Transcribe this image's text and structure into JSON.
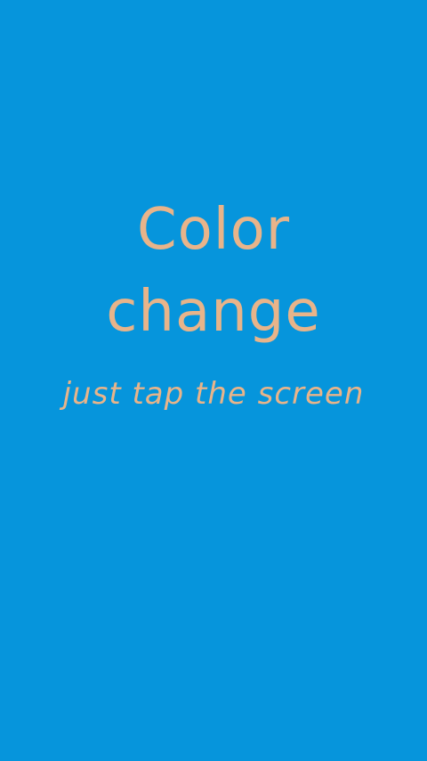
{
  "app": {
    "title_line1": "Color",
    "title_line2": "change",
    "subtitle": "just tap the screen"
  },
  "colors": {
    "background": "#0695DC",
    "text": "#E8B48A"
  }
}
